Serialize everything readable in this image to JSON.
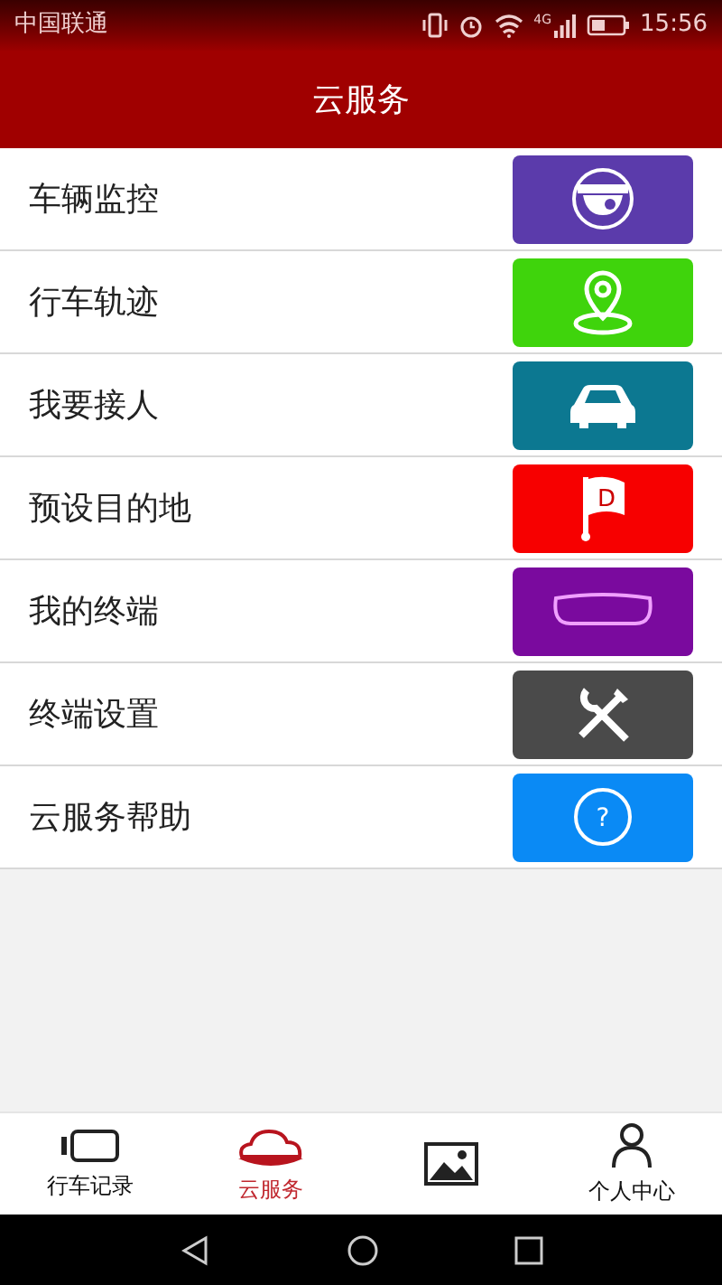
{
  "status_bar": {
    "carrier": "中国联通",
    "network": "4G",
    "time": "15:56"
  },
  "header": {
    "title": "云服务"
  },
  "items": [
    {
      "label": "车辆监控",
      "kind": "camera",
      "color": "#5b3bab"
    },
    {
      "label": "行车轨迹",
      "kind": "location",
      "color": "#3fd40c"
    },
    {
      "label": "我要接人",
      "kind": "car",
      "color": "#0c7891"
    },
    {
      "label": "预设目的地",
      "kind": "flag",
      "color": "#f70000",
      "icon_letter": "D"
    },
    {
      "label": "我的终端",
      "kind": "mirror",
      "color": "#7a0a9e"
    },
    {
      "label": "终端设置",
      "kind": "tools",
      "color": "#4a4a4a"
    },
    {
      "label": "云服务帮助",
      "kind": "help",
      "color": "#0a8af5",
      "icon_letter": "?"
    }
  ],
  "tab_bar": [
    {
      "kind": "recorder",
      "label": "行车记录",
      "selected": false
    },
    {
      "kind": "cloud",
      "label": "云服务",
      "selected": true
    },
    {
      "kind": "album",
      "selected": false
    },
    {
      "kind": "person",
      "label": "个人中心",
      "selected": false
    }
  ]
}
